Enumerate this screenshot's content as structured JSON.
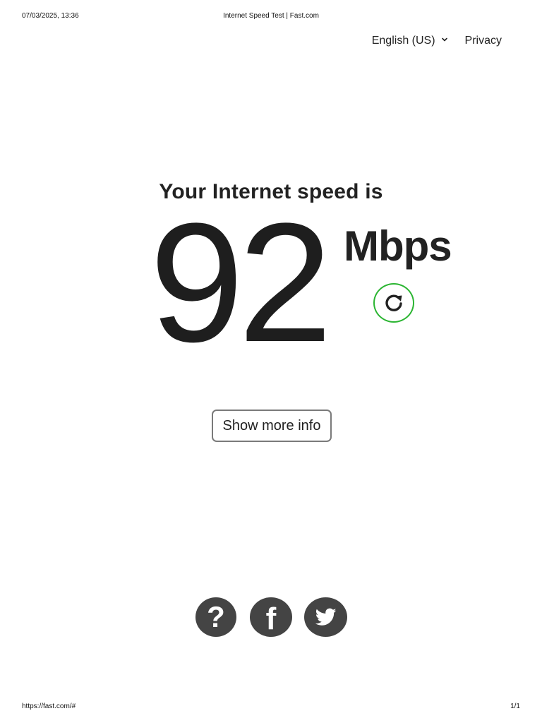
{
  "print_header": {
    "datetime": "07/03/2025, 13:36",
    "title": "Internet Speed Test | Fast.com"
  },
  "print_footer": {
    "url": "https://fast.com/#",
    "page": "1/1"
  },
  "nav": {
    "language": "English (US)",
    "privacy": "Privacy"
  },
  "speed": {
    "label": "Your Internet speed is",
    "value": "92",
    "units": "Mbps"
  },
  "buttons": {
    "show_more": "Show more info",
    "help_glyph": "?",
    "facebook_glyph": "f"
  },
  "icons": {
    "refresh": "refresh-icon",
    "language_chevron": "chevron-down-icon",
    "help": "help-icon",
    "facebook": "facebook-icon",
    "twitter": "twitter-icon"
  },
  "colors": {
    "accent_green": "#2bb532",
    "social_bg": "#444444",
    "text": "#222222"
  }
}
